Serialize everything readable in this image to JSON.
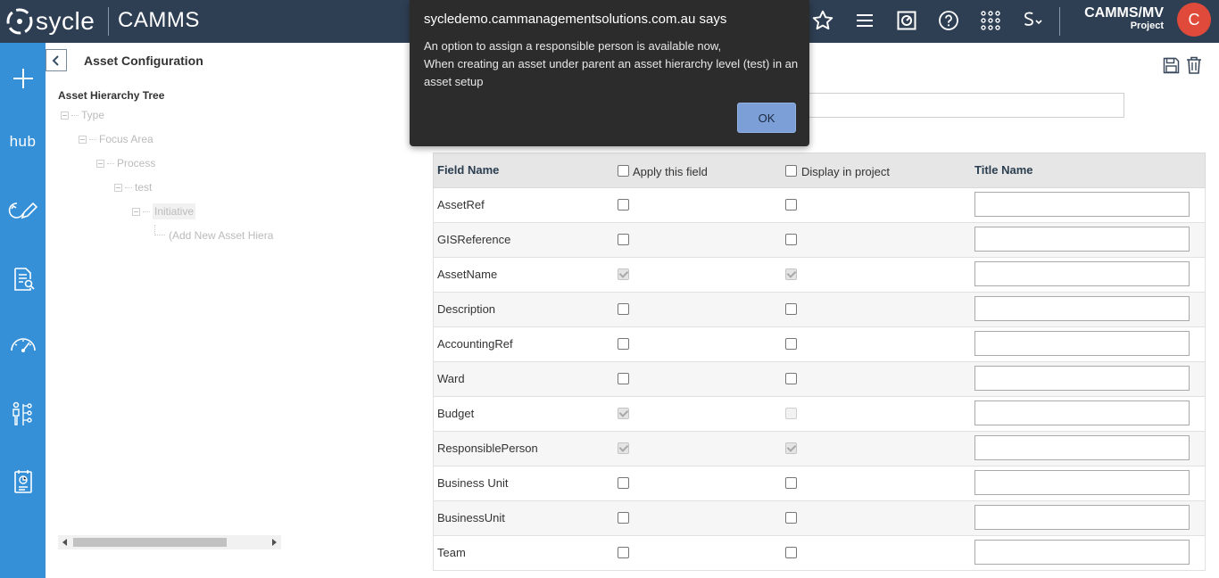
{
  "header": {
    "logo_text": "sycle",
    "app_name": "CAMMS",
    "user_name": "CAMMS/MV",
    "user_role": "Project",
    "avatar_initial": "C",
    "top_icons": [
      "star-icon",
      "menu-icon",
      "dashboard-icon",
      "help-icon",
      "apps-grid-icon",
      "sycle-s-icon"
    ]
  },
  "sidebar": {
    "items": [
      "add-icon",
      "hub",
      "pencil-cycle-icon",
      "document-search-icon",
      "gauge-icon",
      "org-chart-icon",
      "report-icon"
    ],
    "hub_label": "hub"
  },
  "page": {
    "title": "Asset Configuration"
  },
  "tree": {
    "title": "Asset Hierarchy Tree",
    "nodes": [
      {
        "label": "Type"
      },
      {
        "label": "Focus Area"
      },
      {
        "label": "Process"
      },
      {
        "label": "test"
      },
      {
        "label": "Initiative",
        "selected": true
      },
      {
        "label": "(Add New Asset Hiera"
      }
    ]
  },
  "grid": {
    "headers": {
      "field_name": "Field Name",
      "apply": "Apply this field",
      "display": "Display in project",
      "title_name": "Title Name"
    },
    "rows": [
      {
        "name": "AssetRef",
        "apply": "unchecked",
        "display": "unchecked",
        "title": ""
      },
      {
        "name": "GISReference",
        "apply": "unchecked",
        "display": "unchecked",
        "title": ""
      },
      {
        "name": "AssetName",
        "apply": "checked-disabled",
        "display": "checked-disabled",
        "title": ""
      },
      {
        "name": "Description",
        "apply": "unchecked",
        "display": "unchecked",
        "title": ""
      },
      {
        "name": "AccountingRef",
        "apply": "unchecked",
        "display": "unchecked",
        "title": ""
      },
      {
        "name": "Ward",
        "apply": "unchecked",
        "display": "unchecked",
        "title": ""
      },
      {
        "name": "Budget",
        "apply": "checked-disabled",
        "display": "disabled",
        "title": ""
      },
      {
        "name": "ResponsiblePerson",
        "apply": "checked-disabled",
        "display": "checked-disabled",
        "title": ""
      },
      {
        "name": "Business Unit",
        "apply": "unchecked",
        "display": "unchecked",
        "title": ""
      },
      {
        "name": "BusinessUnit",
        "apply": "unchecked",
        "display": "unchecked",
        "title": ""
      },
      {
        "name": "Team",
        "apply": "unchecked",
        "display": "unchecked",
        "title": ""
      }
    ]
  },
  "dialog": {
    "title": "sycledemo.cammanagementsolutions.com.au says",
    "line1": "An option to assign a responsible person is available now,",
    "line2": "When creating an asset under parent an asset hierarchy level (test) in an asset setup",
    "ok_label": "OK"
  },
  "colors": {
    "topbar": "#2f3f53",
    "sidebar": "#3590d8",
    "avatar": "#e04a3a",
    "dialog_bg": "#2c2c2c",
    "ok_button": "#7b9fd6"
  }
}
